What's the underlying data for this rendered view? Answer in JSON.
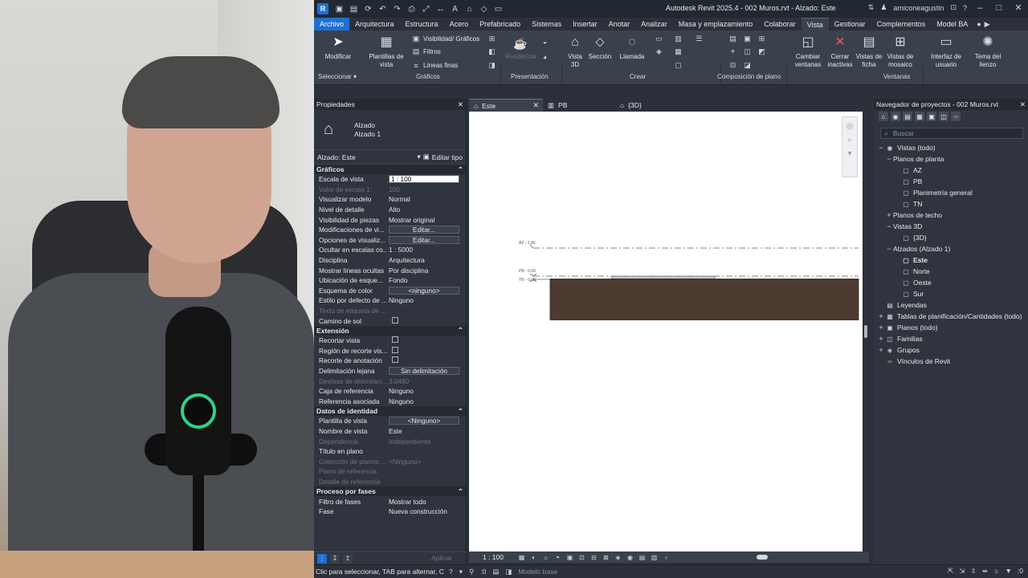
{
  "title": {
    "logo": "R",
    "text": "Autodesk Revit 2025.4 - 002 Muros.rvt - Alzado: Este",
    "user": "amiconeagustin"
  },
  "qat_icons": [
    "open-icon",
    "save-icon",
    "sync-icon",
    "undo-icon",
    "redo-icon",
    "print-icon",
    "measure-icon",
    "dimension-icon",
    "text-icon",
    "3d-house-icon",
    "section-icon",
    "close-windows-icon"
  ],
  "tabs": [
    "Archivo",
    "Arquitectura",
    "Estructura",
    "Acero",
    "Prefabricado",
    "Sistemas",
    "Insertar",
    "Anotar",
    "Analizar",
    "Masa y emplazamiento",
    "Colaborar",
    "Vista",
    "Gestionar",
    "Complementos",
    "Model BA"
  ],
  "active_tab": "Vista",
  "ribbon": {
    "modificar": "Modificar",
    "seleccionar": "Seleccionar",
    "plantillas": "Plantillas de vista",
    "visibilidad": "Visibilidad/ Gráficos",
    "filtros": "Filtros",
    "lineas_finas": "Líneas finas",
    "graficos_panel": "Gráficos",
    "renderizar": "Renderizar",
    "presentacion_panel": "Presentación",
    "vista3d": "Vista 3D",
    "seccion": "Sección",
    "llamada": "Llamada",
    "crear_panel": "Crear",
    "composicion_panel": "Composición de plano",
    "cambiar_ventanas": "Cambiar ventanas",
    "cerrar_inactivas": "Cerrar inactivas",
    "vistas_ficha": "Vistas de ficha",
    "vistas_mosaico": "Vistas de mosaico",
    "interfaz_usuario": "Interfaz de usuario",
    "tema_lienzo": "Tema del lienzo",
    "ventanas_panel": "Ventanas"
  },
  "properties": {
    "header": "Propiedades",
    "type_line1": "Alzado",
    "type_line2": "Alzado 1",
    "selector": "Alzado: Este",
    "edit_type": "Editar tipo",
    "groups": [
      {
        "name": "Gráficos",
        "rows": [
          {
            "k": "Escala de vista",
            "v": "1 : 100",
            "style": "input"
          },
          {
            "k": "Valor de escala    1:",
            "v": "100",
            "dim": true
          },
          {
            "k": "Visualizar modelo",
            "v": "Normal"
          },
          {
            "k": "Nivel de detalle",
            "v": "Alto"
          },
          {
            "k": "Visibilidad de piezas",
            "v": "Mostrar original"
          },
          {
            "k": "Modificaciones de vi...",
            "v": "Editar...",
            "style": "box"
          },
          {
            "k": "Opciones de visualiz...",
            "v": "Editar...",
            "style": "box"
          },
          {
            "k": "Ocultar en escalas co...",
            "v": "1 : 5000"
          },
          {
            "k": "Disciplina",
            "v": "Arquitectura"
          },
          {
            "k": "Mostrar líneas ocultas",
            "v": "Por disciplina"
          },
          {
            "k": "Ubicación de esque...",
            "v": "Fondo"
          },
          {
            "k": "Esquema de color",
            "v": "<ninguno>",
            "style": "box"
          },
          {
            "k": "Estilo por defecto de ...",
            "v": "Ninguno"
          },
          {
            "k": "Texto de etiqueta de ...",
            "v": "",
            "dim": true
          },
          {
            "k": "Camino de sol",
            "v": "",
            "style": "check"
          }
        ]
      },
      {
        "name": "Extensión",
        "rows": [
          {
            "k": "Recortar vista",
            "v": "",
            "style": "check"
          },
          {
            "k": "Región de recorte vis...",
            "v": "",
            "style": "check"
          },
          {
            "k": "Recorte de anotación",
            "v": "",
            "style": "check"
          },
          {
            "k": "Delimitación lejana",
            "v": "Sin delimitación",
            "style": "box"
          },
          {
            "k": "Desfase de delimitaci...",
            "v": "3.0480",
            "dim": true
          },
          {
            "k": "Caja de referencia",
            "v": "Ninguno"
          },
          {
            "k": "Referencia asociada",
            "v": "Ninguno"
          }
        ]
      },
      {
        "name": "Datos de identidad",
        "rows": [
          {
            "k": "Plantilla de vista",
            "v": "<Ninguno>",
            "style": "box"
          },
          {
            "k": "Nombre de vista",
            "v": "Este"
          },
          {
            "k": "Dependencia",
            "v": "Independiente",
            "dim": true
          },
          {
            "k": "Título en plano",
            "v": ""
          },
          {
            "k": "Colección de planos ...",
            "v": "<Ninguno>",
            "dim": true
          },
          {
            "k": "Plano de referencia",
            "v": "",
            "dim": true
          },
          {
            "k": "Detalle de referencia",
            "v": "",
            "dim": true
          }
        ]
      },
      {
        "name": "Proceso por fases",
        "rows": [
          {
            "k": "Filtro de fases",
            "v": "Mostrar todo"
          },
          {
            "k": "Fase",
            "v": "Nueva construcción"
          }
        ]
      }
    ],
    "apply": "Aplicar"
  },
  "view_tabs": [
    {
      "label": "Este",
      "active": true
    },
    {
      "label": "PB",
      "active": false
    },
    {
      "label": "{3D}",
      "active": false
    }
  ],
  "canvas": {
    "levels": [
      {
        "label": "AZ - 2,80"
      },
      {
        "label": "PB - 0,00"
      },
      {
        "label": "TN - 0,00"
      }
    ],
    "wall_color": "#4d3a30",
    "roof_color": "#c8c8c8"
  },
  "view_status": {
    "scale": "1 : 100"
  },
  "browser": {
    "header": "Navegador de proyectos - 002 Muros.rvt",
    "search_placeholder": "Buscar",
    "tree": [
      {
        "label": "Vistas (todo)",
        "level": 0,
        "toggle": "−",
        "icon": "views"
      },
      {
        "label": "Planos de planta",
        "level": 1,
        "toggle": "−"
      },
      {
        "label": "AZ",
        "level": 2,
        "icon": "view"
      },
      {
        "label": "PB",
        "level": 2,
        "icon": "view"
      },
      {
        "label": "Planimetría general",
        "level": 2,
        "icon": "view"
      },
      {
        "label": "TN",
        "level": 2,
        "icon": "view"
      },
      {
        "label": "Planos de techo",
        "level": 1,
        "toggle": "+"
      },
      {
        "label": "Vistas 3D",
        "level": 1,
        "toggle": "−"
      },
      {
        "label": "{3D}",
        "level": 2,
        "icon": "view"
      },
      {
        "label": "Alzados (Alzado 1)",
        "level": 1,
        "toggle": "−"
      },
      {
        "label": "Este",
        "level": 2,
        "icon": "view",
        "selected": true
      },
      {
        "label": "Norte",
        "level": 2,
        "icon": "view"
      },
      {
        "label": "Oeste",
        "level": 2,
        "icon": "view"
      },
      {
        "label": "Sur",
        "level": 2,
        "icon": "view"
      },
      {
        "label": "Leyendas",
        "level": 0,
        "icon": "legend"
      },
      {
        "label": "Tablas de planificación/Cantidades (todo)",
        "level": 0,
        "toggle": "+",
        "icon": "table"
      },
      {
        "label": "Planos (todo)",
        "level": 0,
        "toggle": "+",
        "icon": "sheet"
      },
      {
        "label": "Familias",
        "level": 0,
        "toggle": "+",
        "icon": "family"
      },
      {
        "label": "Grupos",
        "level": 0,
        "toggle": "+",
        "icon": "group"
      },
      {
        "label": "Vínculos de Revit",
        "level": 0,
        "icon": "link"
      }
    ]
  },
  "status": {
    "message": "Clic para seleccionar, TAB para alternar, C",
    "worksets": ":0",
    "model": "Modelo base",
    "filter_count": ":0"
  }
}
